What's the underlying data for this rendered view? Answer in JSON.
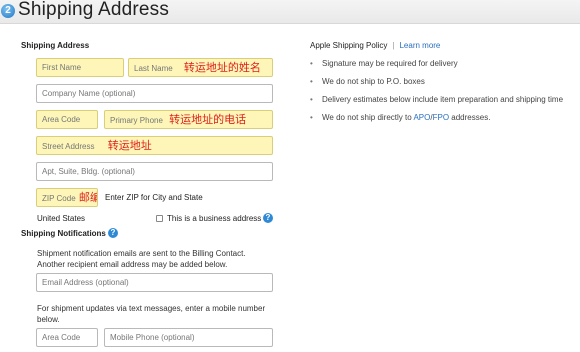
{
  "header": {
    "step_number": "2",
    "title": "Shipping Address"
  },
  "shipping_address": {
    "section_label": "Shipping Address",
    "first_name_placeholder": "First Name",
    "last_name_placeholder": "Last Name",
    "name_annotation": "转运地址的姓名",
    "company_placeholder": "Company Name (optional)",
    "area_code_placeholder": "Area Code",
    "primary_phone_placeholder": "Primary Phone",
    "phone_annotation": "转运地址的电话",
    "street_placeholder": "Street Address",
    "street_annotation": "转运地址",
    "apt_placeholder": "Apt, Suite, Bldg. (optional)",
    "zip_placeholder": "ZIP Code",
    "zip_annotation": "邮编",
    "zip_hint": "Enter ZIP for City and State",
    "country": "United States",
    "business_checkbox_label": "This is a business address",
    "help_icon_glyph": "?"
  },
  "notifications": {
    "section_label": "Shipping Notifications",
    "help_icon_glyph": "?",
    "email_info_line1": "Shipment notification emails are sent to the Billing Contact.",
    "email_info_line2": "Another recipient email address may be added below.",
    "email_placeholder": "Email Address (optional)",
    "sms_info_line1": "For shipment updates via text messages, enter a mobile number",
    "sms_info_line2": "below.",
    "area_code_placeholder": "Area Code",
    "mobile_placeholder": "Mobile Phone (optional)"
  },
  "policy": {
    "title": "Apple Shipping Policy",
    "separator": "|",
    "learn_more": "Learn more",
    "bullet_glyph": "•",
    "item1": "Signature may be required for delivery",
    "item2": "We do not ship to P.O. boxes",
    "item3": "Delivery estimates below include item preparation and shipping time",
    "item4_prefix": "We do not ship directly to ",
    "item4_link1": "APO",
    "item4_slash": "/",
    "item4_link2": "FPO",
    "item4_suffix": " addresses."
  },
  "colors": {
    "highlight_field": "#fdf6b8",
    "annotation_red": "#e0201a",
    "link_blue": "#2a6fc1",
    "badge_blue": "#1f78c8"
  }
}
